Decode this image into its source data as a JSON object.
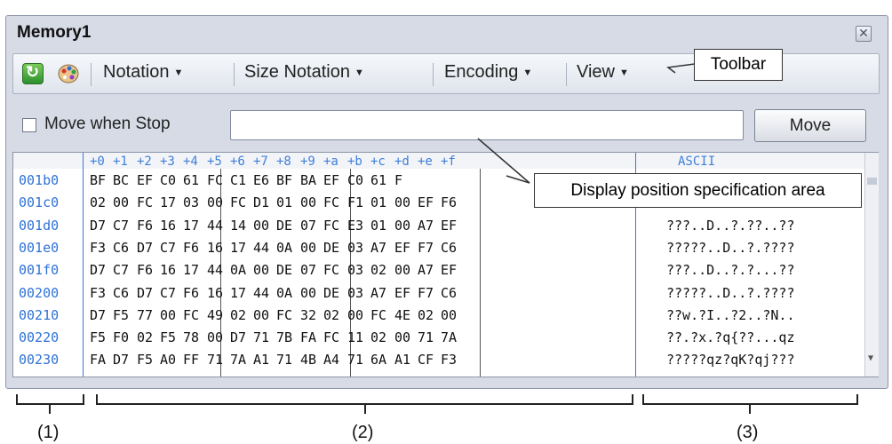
{
  "window": {
    "title": "Memory1",
    "close_icon": "close-icon"
  },
  "toolbar": {
    "refresh_icon": "refresh-icon",
    "palette_icon": "palette-icon",
    "notation": "Notation",
    "size_notation": "Size Notation",
    "encoding": "Encoding",
    "view": "View"
  },
  "callouts": {
    "toolbar": "Toolbar",
    "address_area": "Display position specification area"
  },
  "address_bar": {
    "checkbox_label": "Move when Stop",
    "input_value": "",
    "move_button": "Move"
  },
  "memory": {
    "column_headers": [
      "+0",
      "+1",
      "+2",
      "+3",
      "+4",
      "+5",
      "+6",
      "+7",
      "+8",
      "+9",
      "+a",
      "+b",
      "+c",
      "+d",
      "+e",
      "+f"
    ],
    "ascii_header": "ASCII",
    "rows": [
      {
        "addr": "001b0",
        "bytes": [
          "BF",
          "BC",
          "EF",
          "C0",
          "61",
          "FC",
          "C1",
          "E6",
          "BF",
          "BA",
          "EF",
          "C0",
          "61",
          "F",
          "",
          ""
        ],
        "ascii": ""
      },
      {
        "addr": "001c0",
        "bytes": [
          "02",
          "00",
          "FC",
          "17",
          "03",
          "00",
          "FC",
          "D1",
          "01",
          "00",
          "FC",
          "F1",
          "01",
          "00",
          "EF",
          "F6"
        ],
        "ascii": "..!...!!...!!..!!"
      },
      {
        "addr": "001d0",
        "bytes": [
          "D7",
          "C7",
          "F6",
          "16",
          "17",
          "44",
          "14",
          "00",
          "DE",
          "07",
          "FC",
          "E3",
          "01",
          "00",
          "A7",
          "EF"
        ],
        "ascii": "???..D..?.??..??"
      },
      {
        "addr": "001e0",
        "bytes": [
          "F3",
          "C6",
          "D7",
          "C7",
          "F6",
          "16",
          "17",
          "44",
          "0A",
          "00",
          "DE",
          "03",
          "A7",
          "EF",
          "F7",
          "C6"
        ],
        "ascii": "?????..D..?.????"
      },
      {
        "addr": "001f0",
        "bytes": [
          "D7",
          "C7",
          "F6",
          "16",
          "17",
          "44",
          "0A",
          "00",
          "DE",
          "07",
          "FC",
          "03",
          "02",
          "00",
          "A7",
          "EF"
        ],
        "ascii": "???..D..?.?...??"
      },
      {
        "addr": "00200",
        "bytes": [
          "F3",
          "C6",
          "D7",
          "C7",
          "F6",
          "16",
          "17",
          "44",
          "0A",
          "00",
          "DE",
          "03",
          "A7",
          "EF",
          "F7",
          "C6"
        ],
        "ascii": "?????..D..?.????"
      },
      {
        "addr": "00210",
        "bytes": [
          "D7",
          "F5",
          "77",
          "00",
          "FC",
          "49",
          "02",
          "00",
          "FC",
          "32",
          "02",
          "00",
          "FC",
          "4E",
          "02",
          "00"
        ],
        "ascii": "??w.?I..?2..?N.."
      },
      {
        "addr": "00220",
        "bytes": [
          "F5",
          "F0",
          "02",
          "F5",
          "78",
          "00",
          "D7",
          "71",
          "7B",
          "FA",
          "FC",
          "11",
          "02",
          "00",
          "71",
          "7A"
        ],
        "ascii": "??.?x.?q{??...qz"
      },
      {
        "addr": "00230",
        "bytes": [
          "FA",
          "D7",
          "F5",
          "A0",
          "FF",
          "71",
          "7A",
          "A1",
          "71",
          "4B",
          "A4",
          "71",
          "6A",
          "A1",
          "CF",
          "F3"
        ],
        "ascii": "?????qz?qK?qj???"
      }
    ]
  },
  "labels": {
    "area1": "(1)",
    "area2": "(2)",
    "area3": "(3)"
  }
}
